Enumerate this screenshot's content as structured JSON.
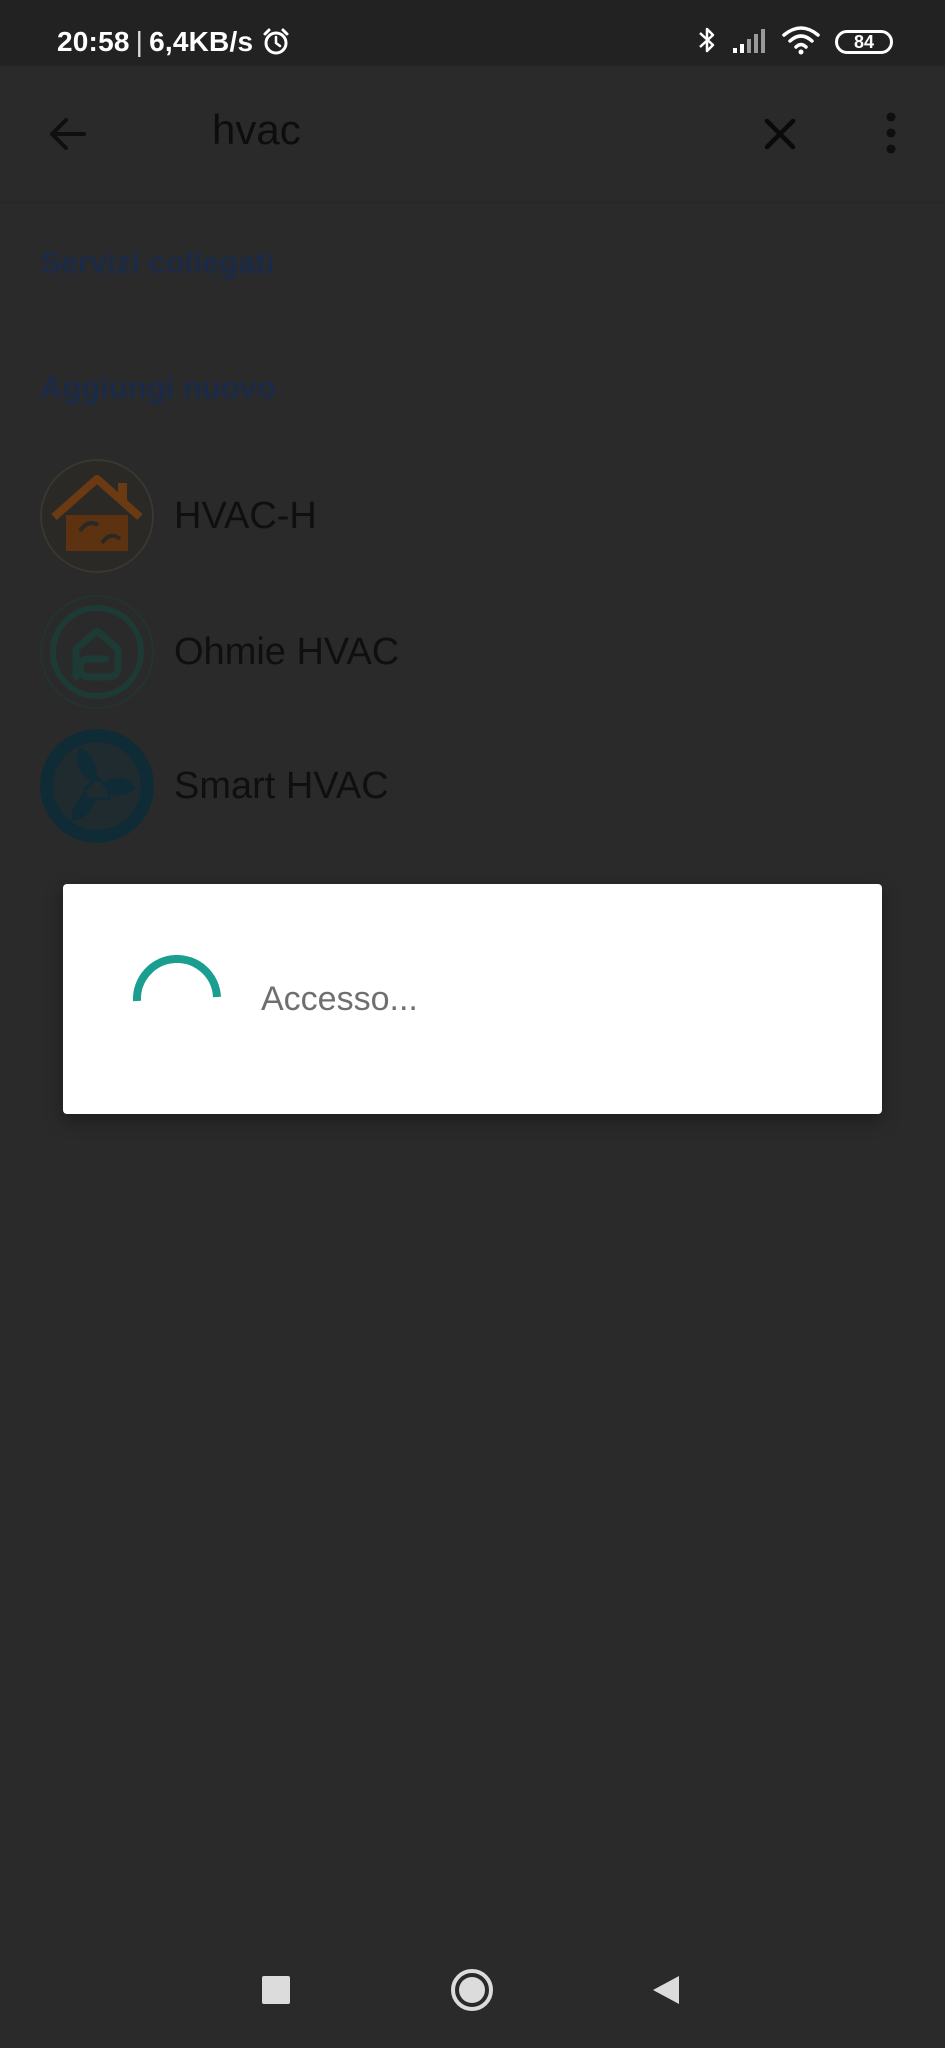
{
  "status_bar": {
    "time": "20:58",
    "separator": "|",
    "network_speed": "6,4KB/s",
    "battery_level": "84",
    "icons": [
      "alarm-icon",
      "bluetooth-icon",
      "signal-icon",
      "wifi-icon",
      "battery-icon"
    ]
  },
  "toolbar": {
    "search_query": "hvac",
    "icons": [
      "back-arrow-icon",
      "close-icon",
      "more-vert-icon"
    ]
  },
  "sections": {
    "linked_title": "Servizi collegati",
    "add_new_title": "Aggiungi nuovo"
  },
  "services": [
    {
      "label": "HVAC-H",
      "icon": "hvac-h-logo"
    },
    {
      "label": "Ohmie HVAC",
      "icon": "ohmie-hvac-logo"
    },
    {
      "label": "Smart HVAC",
      "icon": "smart-hvac-logo"
    }
  ],
  "dialog": {
    "message": "Accesso...",
    "spinner_color": "#1a9e8f"
  },
  "nav_bar": {
    "icons": [
      "recents-icon",
      "home-icon",
      "back-icon"
    ]
  },
  "colors": {
    "scrim_background": "#2a2a2a",
    "status_bar": "#222222",
    "section_title": "#1b2a47",
    "dialog_background": "#ffffff"
  }
}
